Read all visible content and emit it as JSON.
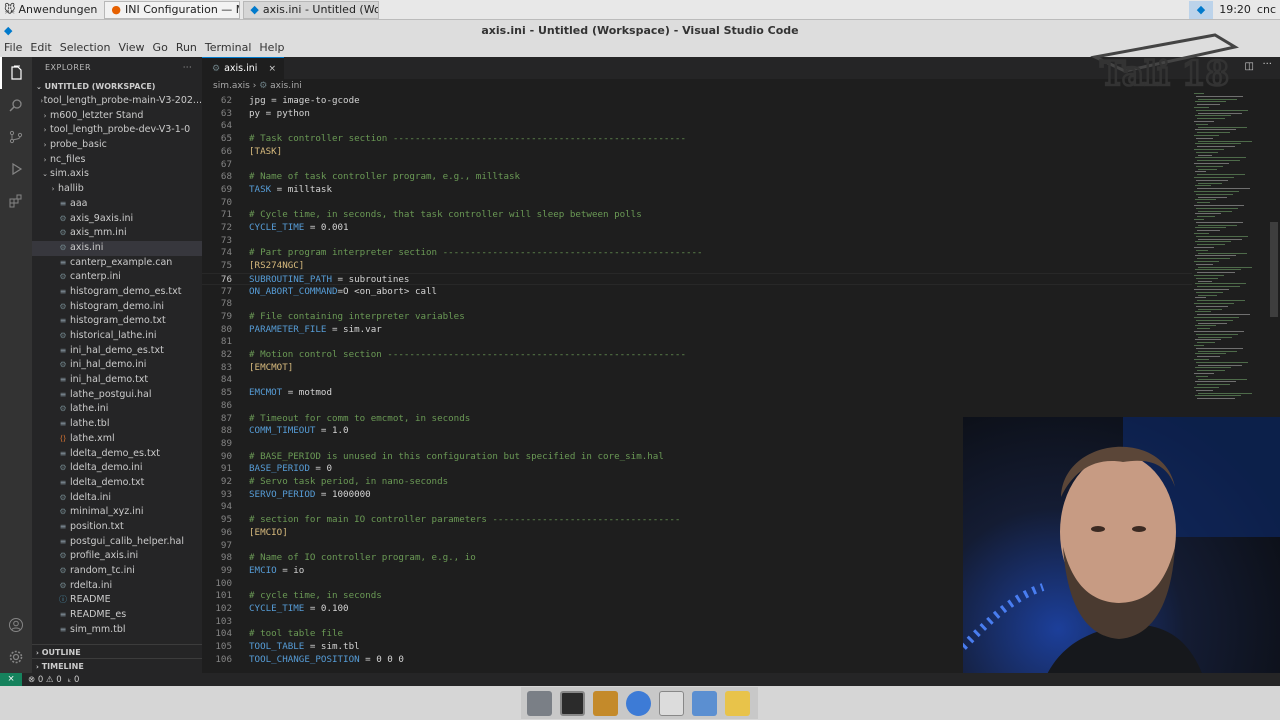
{
  "taskbar": {
    "start_label": "Anwendungen",
    "tasks": [
      {
        "label": "INI Configuration — Moz..."
      },
      {
        "label": "axis.ini - Untitled (Work..."
      }
    ],
    "clock": "19:20",
    "user": "cnc"
  },
  "window": {
    "title": "axis.ini - Untitled (Workspace) - Visual Studio Code"
  },
  "menu": [
    "File",
    "Edit",
    "Selection",
    "View",
    "Go",
    "Run",
    "Terminal",
    "Help"
  ],
  "explorer": {
    "header": "EXPLORER",
    "more": "···",
    "workspace": "UNTITLED (WORKSPACE)",
    "items": [
      {
        "label": "tool_length_probe-main-V3-202...",
        "type": "folder",
        "indent": 0
      },
      {
        "label": "m600_letzter Stand",
        "type": "folder",
        "indent": 0
      },
      {
        "label": "tool_length_probe-dev-V3-1-0",
        "type": "folder",
        "indent": 0
      },
      {
        "label": "probe_basic",
        "type": "folder",
        "indent": 0
      },
      {
        "label": "nc_files",
        "type": "folder",
        "indent": 0
      },
      {
        "label": "sim.axis",
        "type": "folder-open",
        "indent": 0
      },
      {
        "label": "hallib",
        "type": "folder",
        "indent": 1
      },
      {
        "label": "aaa",
        "type": "file",
        "indent": 1
      },
      {
        "label": "axis_9axis.ini",
        "type": "ini",
        "indent": 1
      },
      {
        "label": "axis_mm.ini",
        "type": "ini",
        "indent": 1
      },
      {
        "label": "axis.ini",
        "type": "ini",
        "indent": 1,
        "selected": true
      },
      {
        "label": "canterp_example.can",
        "type": "file",
        "indent": 1
      },
      {
        "label": "canterp.ini",
        "type": "ini",
        "indent": 1
      },
      {
        "label": "histogram_demo_es.txt",
        "type": "txt",
        "indent": 1
      },
      {
        "label": "histogram_demo.ini",
        "type": "ini",
        "indent": 1
      },
      {
        "label": "histogram_demo.txt",
        "type": "txt",
        "indent": 1
      },
      {
        "label": "historical_lathe.ini",
        "type": "ini",
        "indent": 1
      },
      {
        "label": "ini_hal_demo_es.txt",
        "type": "txt",
        "indent": 1
      },
      {
        "label": "ini_hal_demo.ini",
        "type": "ini",
        "indent": 1
      },
      {
        "label": "ini_hal_demo.txt",
        "type": "txt",
        "indent": 1
      },
      {
        "label": "lathe_postgui.hal",
        "type": "file",
        "indent": 1
      },
      {
        "label": "lathe.ini",
        "type": "ini",
        "indent": 1
      },
      {
        "label": "lathe.tbl",
        "type": "file",
        "indent": 1
      },
      {
        "label": "lathe.xml",
        "type": "xml",
        "indent": 1
      },
      {
        "label": "ldelta_demo_es.txt",
        "type": "txt",
        "indent": 1
      },
      {
        "label": "ldelta_demo.ini",
        "type": "ini",
        "indent": 1
      },
      {
        "label": "ldelta_demo.txt",
        "type": "txt",
        "indent": 1
      },
      {
        "label": "ldelta.ini",
        "type": "ini",
        "indent": 1
      },
      {
        "label": "minimal_xyz.ini",
        "type": "ini",
        "indent": 1
      },
      {
        "label": "position.txt",
        "type": "txt",
        "indent": 1
      },
      {
        "label": "postgui_calib_helper.hal",
        "type": "file",
        "indent": 1
      },
      {
        "label": "profile_axis.ini",
        "type": "ini",
        "indent": 1
      },
      {
        "label": "random_tc.ini",
        "type": "ini",
        "indent": 1
      },
      {
        "label": "rdelta.ini",
        "type": "ini",
        "indent": 1
      },
      {
        "label": "README",
        "type": "info",
        "indent": 1
      },
      {
        "label": "README_es",
        "type": "file",
        "indent": 1
      },
      {
        "label": "sim_mm.tbl",
        "type": "file",
        "indent": 1
      }
    ],
    "outline": "OUTLINE",
    "timeline": "TIMELINE"
  },
  "editor": {
    "tab_label": "axis.ini",
    "tab_close": "×",
    "breadcrumb": [
      "sim.axis",
      "axis.ini"
    ],
    "breadcrumb_sep": "›",
    "lines": [
      {
        "n": "62",
        "t": "jpg = image-to-gcode",
        "k": "kv"
      },
      {
        "n": "63",
        "t": "py = python",
        "k": "kv"
      },
      {
        "n": "64",
        "t": "",
        "k": "blank"
      },
      {
        "n": "65",
        "t": "# Task controller section -----------------------------------------------------",
        "k": "comment"
      },
      {
        "n": "66",
        "t": "[TASK]",
        "k": "section"
      },
      {
        "n": "67",
        "t": "",
        "k": "blank"
      },
      {
        "n": "68",
        "t": "# Name of task controller program, e.g., milltask",
        "k": "comment"
      },
      {
        "n": "69",
        "t": "TASK = milltask",
        "k": "kv"
      },
      {
        "n": "70",
        "t": "",
        "k": "blank"
      },
      {
        "n": "71",
        "t": "# Cycle time, in seconds, that task controller will sleep between polls",
        "k": "comment"
      },
      {
        "n": "72",
        "t": "CYCLE_TIME = 0.001",
        "k": "kv"
      },
      {
        "n": "73",
        "t": "",
        "k": "blank"
      },
      {
        "n": "74",
        "t": "# Part program interpreter section -----------------------------------------------",
        "k": "comment"
      },
      {
        "n": "75",
        "t": "[RS274NGC]",
        "k": "section"
      },
      {
        "n": "76",
        "t": "SUBROUTINE_PATH = subroutines",
        "k": "kv"
      },
      {
        "n": "77",
        "t": "ON_ABORT_COMMAND=O <on_abort> call",
        "k": "kv"
      },
      {
        "n": "78",
        "t": "",
        "k": "blank"
      },
      {
        "n": "79",
        "t": "# File containing interpreter variables",
        "k": "comment"
      },
      {
        "n": "80",
        "t": "PARAMETER_FILE = sim.var",
        "k": "kv"
      },
      {
        "n": "81",
        "t": "",
        "k": "blank"
      },
      {
        "n": "82",
        "t": "# Motion control section ------------------------------------------------------",
        "k": "comment"
      },
      {
        "n": "83",
        "t": "[EMCMOT]",
        "k": "section"
      },
      {
        "n": "84",
        "t": "",
        "k": "blank"
      },
      {
        "n": "85",
        "t": "EMCMOT = motmod",
        "k": "kv"
      },
      {
        "n": "86",
        "t": "",
        "k": "blank"
      },
      {
        "n": "87",
        "t": "# Timeout for comm to emcmot, in seconds",
        "k": "comment"
      },
      {
        "n": "88",
        "t": "COMM_TIMEOUT = 1.0",
        "k": "kv"
      },
      {
        "n": "89",
        "t": "",
        "k": "blank"
      },
      {
        "n": "90",
        "t": "# BASE_PERIOD is unused in this configuration but specified in core_sim.hal",
        "k": "comment"
      },
      {
        "n": "91",
        "t": "BASE_PERIOD = 0",
        "k": "kv"
      },
      {
        "n": "92",
        "t": "# Servo task period, in nano-seconds",
        "k": "comment"
      },
      {
        "n": "93",
        "t": "SERVO_PERIOD = 1000000",
        "k": "kv"
      },
      {
        "n": "94",
        "t": "",
        "k": "blank"
      },
      {
        "n": "95",
        "t": "# section for main IO controller parameters ----------------------------------",
        "k": "comment"
      },
      {
        "n": "96",
        "t": "[EMCIO]",
        "k": "section"
      },
      {
        "n": "97",
        "t": "",
        "k": "blank"
      },
      {
        "n": "98",
        "t": "# Name of IO controller program, e.g., io",
        "k": "comment"
      },
      {
        "n": "99",
        "t": "EMCIO = io",
        "k": "kv"
      },
      {
        "n": "100",
        "t": "",
        "k": "blank"
      },
      {
        "n": "101",
        "t": "# cycle time, in seconds",
        "k": "comment"
      },
      {
        "n": "102",
        "t": "CYCLE_TIME = 0.100",
        "k": "kv"
      },
      {
        "n": "103",
        "t": "",
        "k": "blank"
      },
      {
        "n": "104",
        "t": "# tool table file",
        "k": "comment"
      },
      {
        "n": "105",
        "t": "TOOL_TABLE = sim.tbl",
        "k": "kv"
      },
      {
        "n": "106",
        "t": "TOOL_CHANGE_POSITION = 0 0 0",
        "k": "kv"
      }
    ],
    "current_line": "76"
  },
  "status": {
    "remote": "⨯",
    "problems": "⊗ 0 ⚠ 0",
    "ports": "ₖ 0"
  },
  "overlay": {
    "logo_text": "Tali 18"
  },
  "colors": {
    "accent": "#007acc",
    "comment": "#6a9955",
    "section": "#d7ba7d",
    "key": "#569cd6"
  }
}
